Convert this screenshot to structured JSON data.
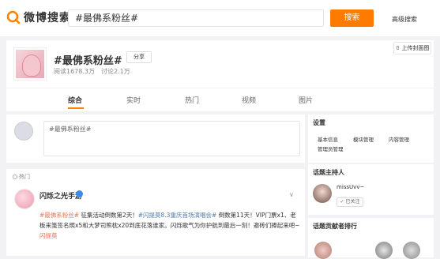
{
  "header": {
    "logo_text": "微博搜索",
    "search_value": "#最佛系粉丝#",
    "search_button": "搜索",
    "advanced_link": "高级搜索"
  },
  "topic": {
    "title": "#最佛系粉丝#",
    "share_label": "分享",
    "read_count": "阅读1678.3万",
    "discuss_count": "讨论2.1万",
    "upload_cover_label": "上传封面图"
  },
  "tabs": [
    {
      "label": "综合"
    },
    {
      "label": "实时"
    },
    {
      "label": "热门"
    },
    {
      "label": "视频"
    },
    {
      "label": "图片"
    }
  ],
  "compose": {
    "placeholder": "#最佛系粉丝#"
  },
  "feed": {
    "section_label": "热门",
    "post": {
      "author": "闪烁之光手游",
      "time": "",
      "text_parts": [
        {
          "text": "#最佛系粉丝#",
          "style": "link"
        },
        {
          "text": " 征集活动倒数第2天！",
          "style": "plain"
        },
        {
          "text": "#闪提莫8.3重庆首场演唱会#",
          "style": "blue"
        },
        {
          "text": " 倒数第11天！VIP门票x1、老板来笺签名照x5和大梦司熊枕x20到底花落谁家。闪烁歌气为你护航到最后一刻！邀砖们捧起来吧~",
          "style": "plain"
        },
        {
          "text": "闪提莫",
          "style": "link"
        }
      ]
    }
  },
  "sidebar": {
    "settings": {
      "title": "设置",
      "items": [
        "基本信息",
        "模块管理",
        "内容管理",
        "管理员管理"
      ]
    },
    "host": {
      "title": "话题主持人",
      "name": "missUvv~",
      "follow_label": "已关注"
    },
    "rank": {
      "title": "话题贡献者排行"
    }
  },
  "colors": {
    "accent": "#ff7b00",
    "link": "#eb7350",
    "blue_link": "#507daf"
  }
}
